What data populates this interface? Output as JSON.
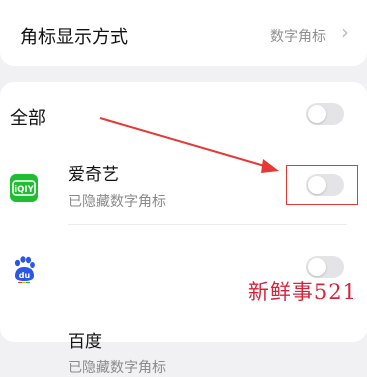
{
  "settings": {
    "badge_style_label": "角标显示方式",
    "badge_style_value": "数字角标",
    "chevron_glyph": "›"
  },
  "apps_section": {
    "all_label": "全部",
    "all_enabled": false,
    "apps": [
      {
        "name": "爱奇艺",
        "status": "已隐藏数字角标",
        "enabled": false,
        "icon": "iqiyi-icon",
        "icon_text": "iQIY"
      },
      {
        "name": "百度",
        "status": "已隐藏数字角标",
        "enabled": false,
        "icon": "baidu-paw-icon",
        "icon_text": "du"
      }
    ]
  },
  "annotation": {
    "arrow_color": "#e53935",
    "box_color": "#e53935"
  },
  "watermark": {
    "text": "新鲜事521"
  },
  "colors": {
    "background": "#f1f1f3",
    "toggle_off": "#e4e4e6",
    "iqiyi_green": "#1fbe32",
    "baidu_blue": "#2b56e6"
  }
}
